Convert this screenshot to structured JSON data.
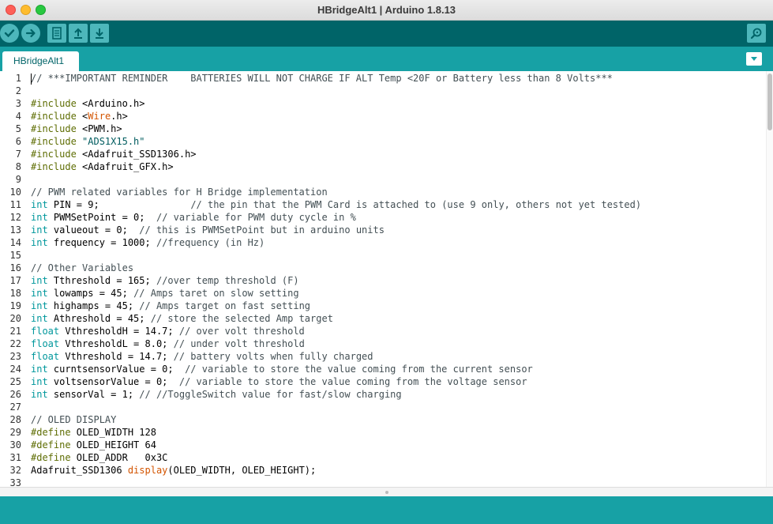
{
  "window": {
    "title": "HBridgeAlt1 | Arduino 1.8.13"
  },
  "toolbar": {
    "buttons": [
      "verify",
      "upload",
      "new",
      "open",
      "save",
      "serial-monitor"
    ]
  },
  "tabs": [
    {
      "label": "HBridgeAlt1"
    }
  ],
  "colors": {
    "toolbar": "#006468",
    "tabstrip": "#17a1a5",
    "comment": "#434f54",
    "preprocessor": "#5e6d03",
    "type": "#00979c",
    "function": "#d35400"
  },
  "editor": {
    "lines": [
      [
        {
          "t": "// ***IMPORTANT REMINDER    BATTERIES WILL NOT CHARGE IF ALT Temp <20F or Battery less than 8 Volts***",
          "c": "comment"
        }
      ],
      [],
      [
        {
          "t": "#include ",
          "c": "pre"
        },
        {
          "t": "<Arduino.h>",
          "c": ""
        }
      ],
      [
        {
          "t": "#include ",
          "c": "pre"
        },
        {
          "t": "<",
          "c": ""
        },
        {
          "t": "Wire",
          "c": "func"
        },
        {
          "t": ".h>",
          "c": ""
        }
      ],
      [
        {
          "t": "#include ",
          "c": "pre"
        },
        {
          "t": "<PWM.h>",
          "c": ""
        }
      ],
      [
        {
          "t": "#include ",
          "c": "pre"
        },
        {
          "t": "\"ADS1X15.h\"",
          "c": "str"
        }
      ],
      [
        {
          "t": "#include ",
          "c": "pre"
        },
        {
          "t": "<Adafruit_SSD1306.h>",
          "c": ""
        }
      ],
      [
        {
          "t": "#include ",
          "c": "pre"
        },
        {
          "t": "<Adafruit_GFX.h>",
          "c": ""
        }
      ],
      [],
      [
        {
          "t": "// PWM related variables for H Bridge implementation",
          "c": "comment"
        }
      ],
      [
        {
          "t": "int",
          "c": "type"
        },
        {
          "t": " PIN = 9;                ",
          "c": ""
        },
        {
          "t": "// the pin that the PWM Card is attached to (use 9 only, others not yet tested)",
          "c": "comment"
        }
      ],
      [
        {
          "t": "int",
          "c": "type"
        },
        {
          "t": " PWMSetPoint = 0;  ",
          "c": ""
        },
        {
          "t": "// variable for PWM duty cycle in %",
          "c": "comment"
        }
      ],
      [
        {
          "t": "int",
          "c": "type"
        },
        {
          "t": " valueout = 0;  ",
          "c": ""
        },
        {
          "t": "// this is PWMSetPoint but in arduino units",
          "c": "comment"
        }
      ],
      [
        {
          "t": "int",
          "c": "type"
        },
        {
          "t": " frequency = 1000; ",
          "c": ""
        },
        {
          "t": "//frequency (in Hz)",
          "c": "comment"
        }
      ],
      [],
      [
        {
          "t": "// Other Variables",
          "c": "comment"
        }
      ],
      [
        {
          "t": "int",
          "c": "type"
        },
        {
          "t": " Tthreshold = 165; ",
          "c": ""
        },
        {
          "t": "//over temp threshold (F)",
          "c": "comment"
        }
      ],
      [
        {
          "t": "int",
          "c": "type"
        },
        {
          "t": " lowamps = 45; ",
          "c": ""
        },
        {
          "t": "// Amps taret on slow setting",
          "c": "comment"
        }
      ],
      [
        {
          "t": "int",
          "c": "type"
        },
        {
          "t": " highamps = 45; ",
          "c": ""
        },
        {
          "t": "// Amps target on fast setting",
          "c": "comment"
        }
      ],
      [
        {
          "t": "int",
          "c": "type"
        },
        {
          "t": " Athreshold = 45; ",
          "c": ""
        },
        {
          "t": "// store the selected Amp target",
          "c": "comment"
        }
      ],
      [
        {
          "t": "float",
          "c": "type"
        },
        {
          "t": " VthresholdH = 14.7; ",
          "c": ""
        },
        {
          "t": "// over volt threshold",
          "c": "comment"
        }
      ],
      [
        {
          "t": "float",
          "c": "type"
        },
        {
          "t": " VthresholdL = 8.0; ",
          "c": ""
        },
        {
          "t": "// under volt threshold",
          "c": "comment"
        }
      ],
      [
        {
          "t": "float",
          "c": "type"
        },
        {
          "t": " Vthreshold = 14.7; ",
          "c": ""
        },
        {
          "t": "// battery volts when fully charged",
          "c": "comment"
        }
      ],
      [
        {
          "t": "int",
          "c": "type"
        },
        {
          "t": " curntsensorValue = 0;  ",
          "c": ""
        },
        {
          "t": "// variable to store the value coming from the current sensor",
          "c": "comment"
        }
      ],
      [
        {
          "t": "int",
          "c": "type"
        },
        {
          "t": " voltsensorValue = 0;  ",
          "c": ""
        },
        {
          "t": "// variable to store the value coming from the voltage sensor",
          "c": "comment"
        }
      ],
      [
        {
          "t": "int",
          "c": "type"
        },
        {
          "t": " sensorVal = 1; ",
          "c": ""
        },
        {
          "t": "// //ToggleSwitch value for fast/slow charging",
          "c": "comment"
        }
      ],
      [],
      [
        {
          "t": "// OLED DISPLAY",
          "c": "comment"
        }
      ],
      [
        {
          "t": "#define ",
          "c": "pre"
        },
        {
          "t": "OLED_WIDTH 128",
          "c": ""
        }
      ],
      [
        {
          "t": "#define ",
          "c": "pre"
        },
        {
          "t": "OLED_HEIGHT 64",
          "c": ""
        }
      ],
      [
        {
          "t": "#define ",
          "c": "pre"
        },
        {
          "t": "OLED_ADDR   0x3C",
          "c": ""
        }
      ],
      [
        {
          "t": "Adafruit_SSD1306 ",
          "c": ""
        },
        {
          "t": "display",
          "c": "func"
        },
        {
          "t": "(OLED_WIDTH, OLED_HEIGHT);",
          "c": ""
        }
      ],
      []
    ]
  }
}
